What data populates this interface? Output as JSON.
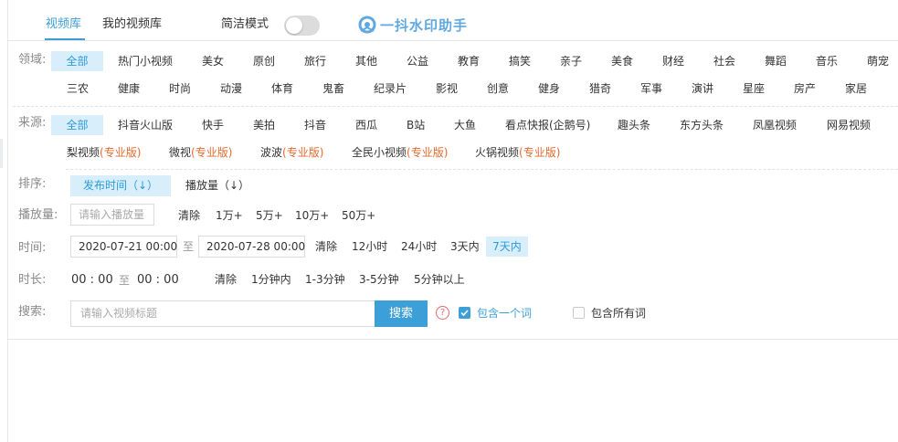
{
  "header": {
    "tabs": [
      "视频库",
      "我的视频库"
    ],
    "toggle_label": "简洁模式",
    "logo_text": "一抖水印助手"
  },
  "domain": {
    "label": "领域:",
    "row1": [
      "全部",
      "热门小视频",
      "美女",
      "原创",
      "旅行",
      "其他",
      "公益",
      "教育",
      "搞笑",
      "亲子",
      "美食",
      "财经",
      "社会",
      "舞蹈",
      "音乐",
      "萌宠"
    ],
    "row2": [
      "三农",
      "健康",
      "时尚",
      "动漫",
      "体育",
      "鬼畜",
      "纪录片",
      "影视",
      "创意",
      "健身",
      "猎奇",
      "军事",
      "演讲",
      "星座",
      "房产",
      "家居"
    ]
  },
  "source": {
    "label": "来源:",
    "row1": [
      "全部",
      "抖音火山版",
      "快手",
      "美拍",
      "抖音",
      "西瓜",
      "B站",
      "大鱼",
      "看点快报(企鹅号)",
      "趣头条",
      "东方头条",
      "凤凰视频",
      "网易视频"
    ],
    "row2": [
      {
        "name": "梨视频",
        "tag": "(专业版)"
      },
      {
        "name": "微视",
        "tag": "(专业版)"
      },
      {
        "name": "波波",
        "tag": "(专业版)"
      },
      {
        "name": "全民小视频",
        "tag": "(专业版)"
      },
      {
        "name": "火锅视频",
        "tag": "(专业版)"
      }
    ]
  },
  "sort": {
    "label": "排序:",
    "options": [
      "发布时间（↓）",
      "播放量（↓）"
    ]
  },
  "plays": {
    "label": "播放量:",
    "placeholder": "请输入播放量",
    "options": [
      "清除",
      "1万+",
      "5万+",
      "10万+",
      "50万+"
    ]
  },
  "time": {
    "label": "时间:",
    "start": "2020-07-21 00:00",
    "to": "至",
    "end": "2020-07-28 00:00",
    "options": [
      "清除",
      "12小时",
      "24小时",
      "3天内",
      "7天内"
    ]
  },
  "duration": {
    "label": "时长:",
    "start": "00 : 00",
    "to": "至",
    "end": "00 : 00",
    "options": [
      "清除",
      "1分钟内",
      "1-3分钟",
      "3-5分钟",
      "5分钟以上"
    ]
  },
  "search": {
    "label": "搜索:",
    "placeholder": "请输入视频标题",
    "button": "搜索",
    "help": "?",
    "option_any": "包含一个词",
    "option_all": "包含所有词"
  },
  "colors": {
    "accent": "#3d9fd7",
    "active_bg": "#d9eefb",
    "pro": "#e36a2e"
  }
}
